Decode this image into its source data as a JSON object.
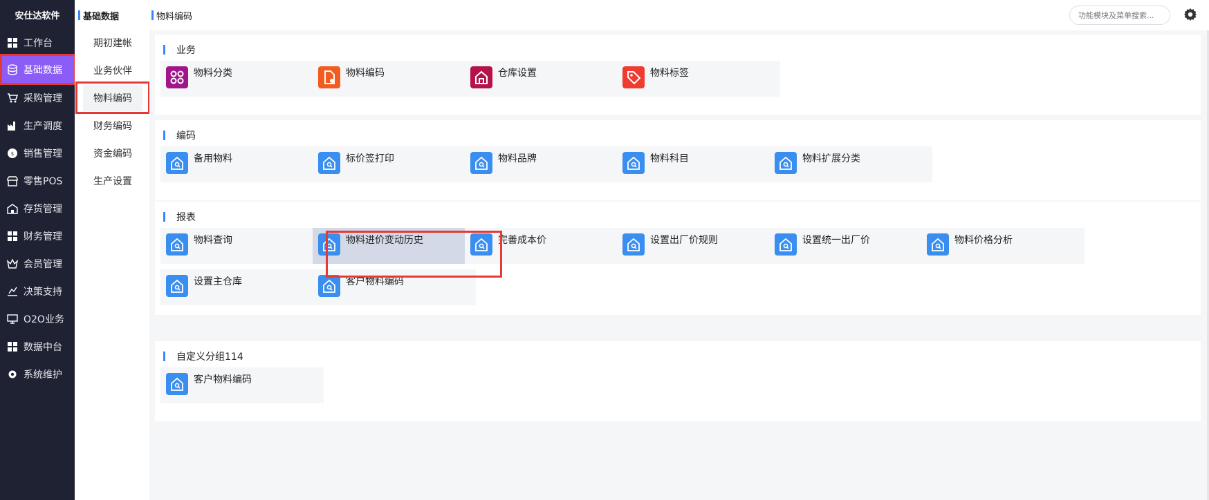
{
  "sidebar": {
    "brand": "安仕达软件",
    "items": [
      {
        "label": "工作台",
        "icon": "grid-icon"
      },
      {
        "label": "基础数据",
        "icon": "database-icon",
        "active": true
      },
      {
        "label": "采购管理",
        "icon": "cart-icon"
      },
      {
        "label": "生产调度",
        "icon": "factory-icon"
      },
      {
        "label": "销售管理",
        "icon": "sales-icon"
      },
      {
        "label": "零售POS",
        "icon": "store-icon"
      },
      {
        "label": "存货管理",
        "icon": "warehouse-icon"
      },
      {
        "label": "财务管理",
        "icon": "grid-icon"
      },
      {
        "label": "会员管理",
        "icon": "crown-icon"
      },
      {
        "label": "决策支持",
        "icon": "chart-icon"
      },
      {
        "label": "O2O业务",
        "icon": "monitor-icon"
      },
      {
        "label": "数据中台",
        "icon": "grid-icon"
      },
      {
        "label": "系统维护",
        "icon": "gear-icon"
      }
    ]
  },
  "submenu": {
    "title": "基础数据",
    "items": [
      {
        "label": "期初建帐"
      },
      {
        "label": "业务伙伴"
      },
      {
        "label": "物料编码",
        "active": true
      },
      {
        "label": "财务编码"
      },
      {
        "label": "资金编码"
      },
      {
        "label": "生产设置"
      }
    ]
  },
  "topbar": {
    "title": "物料编码",
    "search_placeholder": "功能模块及菜单搜索..."
  },
  "groups": [
    {
      "title": "业务",
      "tiles": [
        {
          "label": "物料分类",
          "icon": "category-icon",
          "color": "#a0168a"
        },
        {
          "label": "物料编码",
          "icon": "file-gear-icon",
          "color": "#f25c1e"
        },
        {
          "label": "仓库设置",
          "icon": "house-icon",
          "color": "#b5124a"
        },
        {
          "label": "物料标签",
          "icon": "tag-icon",
          "color": "#ef3b30"
        }
      ]
    },
    {
      "title": "编码",
      "tiles": [
        {
          "label": "备用物料",
          "icon": "house-search-icon"
        },
        {
          "label": "标价签打印",
          "icon": "house-search-icon"
        },
        {
          "label": "物料品牌",
          "icon": "house-search-icon"
        },
        {
          "label": "物料科目",
          "icon": "house-search-icon"
        },
        {
          "label": "物料扩展分类",
          "icon": "house-search-icon"
        }
      ]
    },
    {
      "title": "报表",
      "tiles": [
        {
          "label": "物料查询",
          "icon": "house-search-icon"
        },
        {
          "label": "物料进价变动历史",
          "icon": "house-search-icon",
          "highlight": true
        },
        {
          "label": "完善成本价",
          "icon": "house-search-icon"
        },
        {
          "label": "设置出厂价规则",
          "icon": "house-search-icon"
        },
        {
          "label": "设置统一出厂价",
          "icon": "house-search-icon"
        },
        {
          "label": "物料价格分析",
          "icon": "house-search-icon"
        },
        {
          "label": "设置主仓库",
          "icon": "house-search-icon"
        },
        {
          "label": "客户物料编码",
          "icon": "house-search-icon"
        }
      ]
    },
    {
      "title": "自定义分组114",
      "tiles": [
        {
          "label": "客户物料编码",
          "icon": "house-search-icon"
        }
      ]
    }
  ],
  "colors": {
    "accent": "#3a86ff",
    "sidebar_bg": "#1f2233",
    "active": "#8b5cf6",
    "tile_blue": "#3a8ef0",
    "highlight_box": "#e53935"
  }
}
